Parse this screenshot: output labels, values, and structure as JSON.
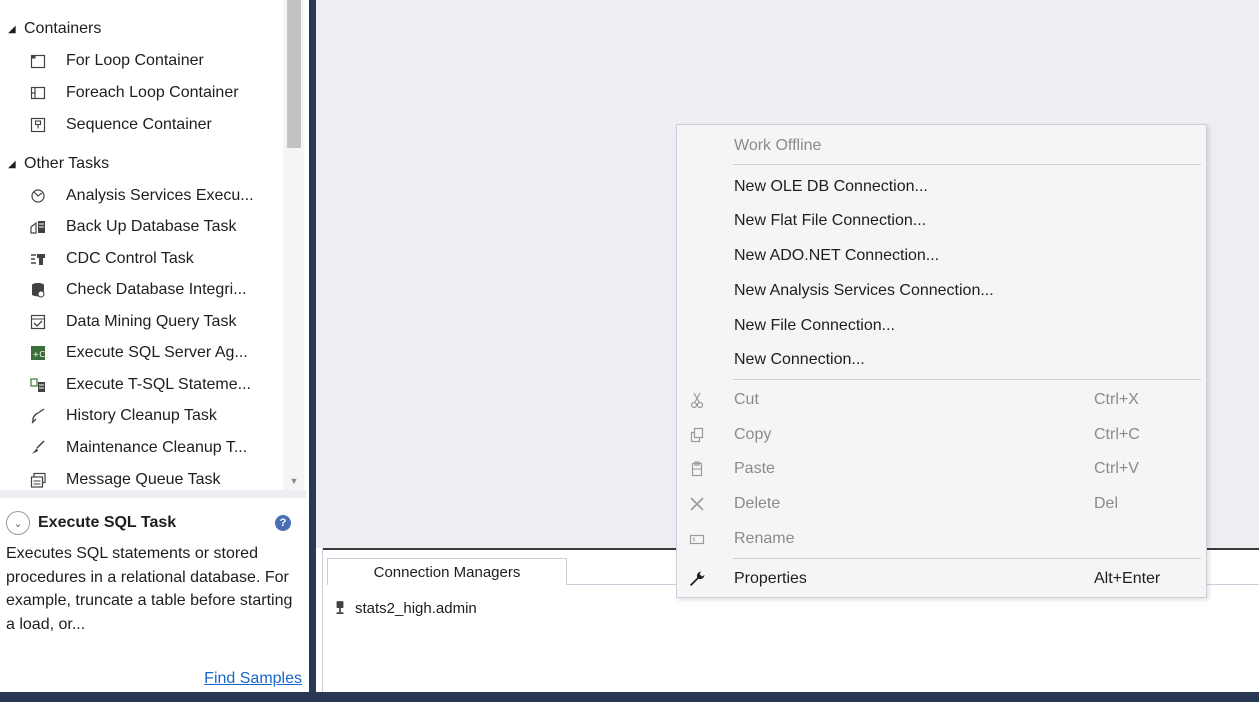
{
  "toolbox": {
    "groups": [
      {
        "name": "Containers",
        "items": [
          {
            "label": "For Loop Container",
            "icon": "for-loop-icon"
          },
          {
            "label": "Foreach Loop Container",
            "icon": "foreach-loop-icon"
          },
          {
            "label": "Sequence Container",
            "icon": "sequence-container-icon"
          }
        ]
      },
      {
        "name": "Other Tasks",
        "items": [
          {
            "label": "Analysis Services Execu...",
            "icon": "analysis-services-icon"
          },
          {
            "label": "Back Up Database Task",
            "icon": "backup-database-icon"
          },
          {
            "label": "CDC Control Task",
            "icon": "cdc-control-icon"
          },
          {
            "label": "Check Database Integri...",
            "icon": "check-database-icon"
          },
          {
            "label": "Data Mining Query Task",
            "icon": "data-mining-icon"
          },
          {
            "label": "Execute SQL Server Ag...",
            "icon": "sql-agent-icon"
          },
          {
            "label": "Execute T-SQL Stateme...",
            "icon": "tsql-statement-icon"
          },
          {
            "label": "History Cleanup Task",
            "icon": "history-cleanup-icon"
          },
          {
            "label": "Maintenance Cleanup T...",
            "icon": "maintenance-cleanup-icon"
          },
          {
            "label": "Message Queue Task",
            "icon": "message-queue-icon"
          }
        ]
      }
    ]
  },
  "description": {
    "title": "Execute SQL Task",
    "text": "Executes SQL statements or stored procedures in a relational database. For example, truncate a table before starting a load, or...",
    "link": "Find Samples",
    "help_icon": "help-icon"
  },
  "connection_managers": {
    "tab_label": "Connection Managers",
    "items": [
      {
        "label": "stats2_high.admin",
        "icon": "connection-plug-icon"
      }
    ]
  },
  "context_menu": {
    "items": [
      {
        "label": "Work Offline",
        "disabled": true
      },
      {
        "label": "New OLE DB Connection..."
      },
      {
        "label": "New Flat File Connection..."
      },
      {
        "label": "New ADO.NET Connection..."
      },
      {
        "label": "New Analysis Services Connection..."
      },
      {
        "label": "New File Connection..."
      },
      {
        "label": "New Connection..."
      },
      {
        "label": "Cut",
        "shortcut": "Ctrl+X",
        "icon": "scissors-icon",
        "disabled": true
      },
      {
        "label": "Copy",
        "shortcut": "Ctrl+C",
        "icon": "copy-icon",
        "disabled": true
      },
      {
        "label": "Paste",
        "shortcut": "Ctrl+V",
        "icon": "paste-icon",
        "disabled": true
      },
      {
        "label": "Delete",
        "shortcut": "Del",
        "icon": "delete-x-icon",
        "disabled": true
      },
      {
        "label": "Rename",
        "icon": "rename-icon",
        "disabled": true
      },
      {
        "label": "Properties",
        "shortcut": "Alt+Enter",
        "icon": "wrench-icon"
      }
    ]
  },
  "colors": {
    "frame": "#293955",
    "surface": "#eeeef2",
    "menu_bg": "#f5f5f5",
    "link": "#1a66c9",
    "disabled_text": "#8b8b8b"
  }
}
